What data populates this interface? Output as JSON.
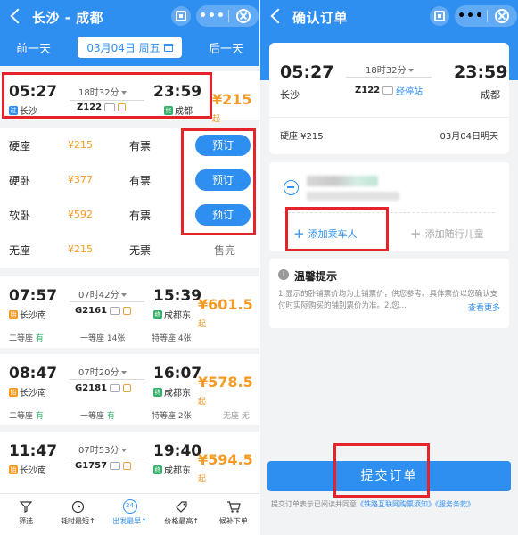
{
  "left": {
    "header": {
      "title": "长沙 - 成都"
    },
    "datebar": {
      "prev": "前一天",
      "date": "03月04日 周五",
      "next": "后一天"
    },
    "selected_train": {
      "depart_time": "05:27",
      "arrive_time": "23:59",
      "duration": "18时32分",
      "train_no": "Z122",
      "from": "长沙",
      "to": "成都",
      "from_tag": "过",
      "to_tag": "终",
      "price": "¥215",
      "price_suffix": "起"
    },
    "seats": [
      {
        "name": "硬座",
        "price": "¥215",
        "avail": "有票",
        "action": "预订"
      },
      {
        "name": "硬卧",
        "price": "¥377",
        "avail": "有票",
        "action": "预订"
      },
      {
        "name": "软卧",
        "price": "¥592",
        "avail": "有票",
        "action": "预订"
      },
      {
        "name": "无座",
        "price": "¥215",
        "avail": "无票",
        "action": "售完"
      }
    ],
    "trains": [
      {
        "depart_time": "07:57",
        "arrive_time": "15:39",
        "duration": "07时42分",
        "train_no": "G2161",
        "from": "长沙南",
        "to": "成都东",
        "price": "¥601.5",
        "price_suffix": "起",
        "seat_a": "二等座",
        "seat_a_v": "有",
        "seat_b": "一等座",
        "seat_b_v": "14张",
        "seat_c": "特等座",
        "seat_c_v": "4张",
        "seat_d": "",
        "seat_d_v": ""
      },
      {
        "depart_time": "08:47",
        "arrive_time": "16:07",
        "duration": "07时20分",
        "train_no": "G2181",
        "from": "长沙南",
        "to": "成都东",
        "price": "¥578.5",
        "price_suffix": "起",
        "seat_a": "二等座",
        "seat_a_v": "有",
        "seat_b": "一等座",
        "seat_b_v": "有",
        "seat_c": "特等座",
        "seat_c_v": "2张",
        "seat_d": "无座",
        "seat_d_v": "无"
      },
      {
        "depart_time": "11:47",
        "arrive_time": "19:40",
        "duration": "07时53分",
        "train_no": "G1757",
        "from": "长沙南",
        "to": "成都东",
        "price": "¥594.5",
        "price_suffix": "起"
      }
    ],
    "nav": [
      {
        "label": "筛选",
        "icon": "filter-icon"
      },
      {
        "label": "耗时最短↑",
        "icon": "clock-icon"
      },
      {
        "label": "出发最早↑",
        "icon": "24h-icon",
        "active": true,
        "ring": "24"
      },
      {
        "label": "价格最高↑",
        "icon": "price-tag-icon"
      },
      {
        "label": "候补下单",
        "icon": "cart-icon"
      }
    ]
  },
  "right": {
    "header": {
      "title": "确认订单"
    },
    "ticket": {
      "depart_time": "05:27",
      "arrive_time": "23:59",
      "duration": "18时32分",
      "train_no": "Z122",
      "stop_link": "经停站",
      "from": "长沙",
      "to": "成都",
      "seat_price": "硬座 ¥215",
      "arrive_date": "03月04日明天"
    },
    "passenger": {
      "add_passenger": "添加乘车人",
      "add_child": "添加随行儿童"
    },
    "tips": {
      "title": "温馨提示",
      "text": "1.显示的卧铺票价均为上铺票价，供您参考。具体票价以您确认支付时实际购买的铺别票价为准。2.您...",
      "more": "查看更多"
    },
    "submit": "提交订单",
    "agree_prefix": "提交订单表示已阅读并同意",
    "agree_link1": "《铁路互联网购票须知》",
    "agree_link2": "《服务条款》"
  },
  "colors": {
    "accent": "#2e8ff0",
    "price": "#f59b23",
    "highlight_box": "#e5232b",
    "available": "#35b06a"
  }
}
